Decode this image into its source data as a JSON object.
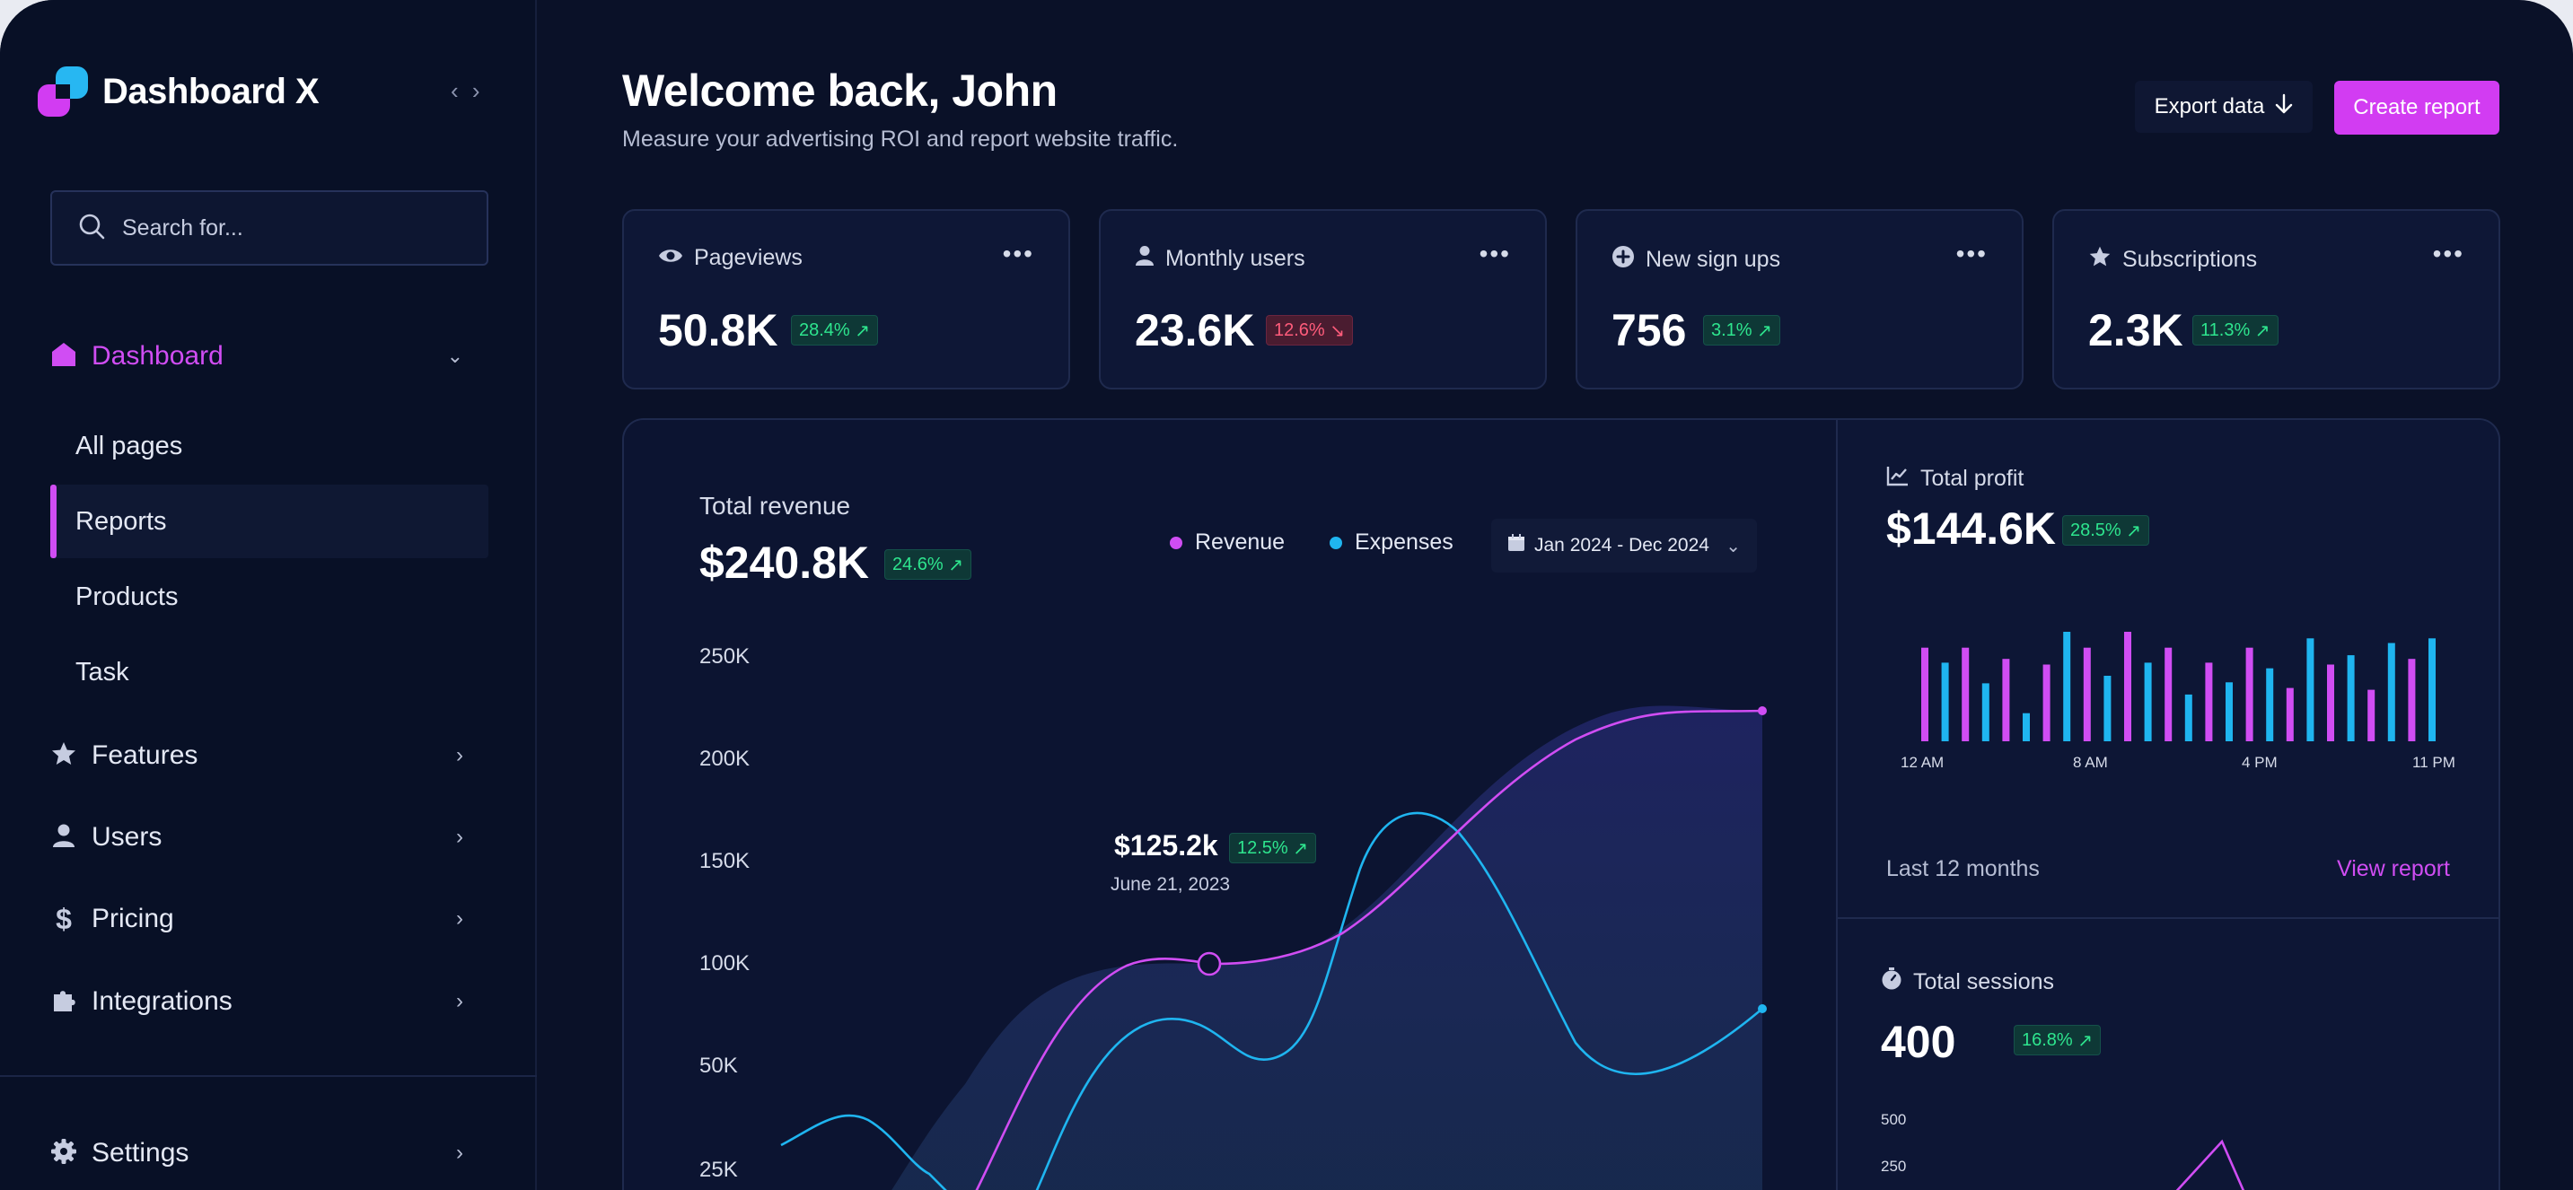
{
  "app": {
    "name": "Dashboard X"
  },
  "sidebar": {
    "search_placeholder": "Search for...",
    "main_item": "Dashboard",
    "sub_items": [
      "All pages",
      "Reports",
      "Products",
      "Task"
    ],
    "active_sub_item": "Reports",
    "items": [
      "Features",
      "Users",
      "Pricing",
      "Integrations"
    ],
    "settings_label": "Settings"
  },
  "header": {
    "title": "Welcome back, John",
    "subtitle": "Measure your advertising ROI and report website traffic.",
    "export_label": "Export data",
    "create_label": "Create report"
  },
  "stats": [
    {
      "label": "Pageviews",
      "value": "50.8K",
      "change": "28.4%",
      "trend": "up",
      "icon": "eye-icon"
    },
    {
      "label": "Monthly users",
      "value": "23.6K",
      "change": "12.6%",
      "trend": "down",
      "icon": "user-icon"
    },
    {
      "label": "New sign ups",
      "value": "756",
      "change": "3.1%",
      "trend": "up",
      "icon": "plus-circle-icon"
    },
    {
      "label": "Subscriptions",
      "value": "2.3K",
      "change": "11.3%",
      "trend": "up",
      "icon": "star-icon"
    }
  ],
  "revenue": {
    "label": "Total revenue",
    "value": "$240.8K",
    "change": "24.6%",
    "legend": [
      "Revenue",
      "Expenses"
    ],
    "date_range": "Jan 2024 - Dec 2024",
    "tooltip": {
      "value": "$125.2k",
      "change": "12.5%",
      "date": "June 21, 2023"
    }
  },
  "profit": {
    "label": "Total profit",
    "value": "$144.6K",
    "change": "28.5%",
    "hour_labels": [
      "12 AM",
      "8 AM",
      "4 PM",
      "11 PM"
    ],
    "footer_label": "Last 12 months",
    "link_label": "View report"
  },
  "sessions": {
    "label": "Total sessions",
    "value": "400",
    "change": "16.8%",
    "y_ticks": [
      "500",
      "250"
    ]
  },
  "colors": {
    "accent": "#d04df3",
    "revenue": "#d04df3",
    "expenses": "#1fb5f0",
    "positive": "#2ee58e",
    "negative": "#ff5c7b"
  },
  "chart_data": [
    {
      "type": "area",
      "title": "Total revenue",
      "y_ticks": [
        "250K",
        "200K",
        "150K",
        "100K",
        "50K",
        "25K"
      ],
      "ylim": [
        25000,
        250000
      ],
      "series": [
        {
          "name": "Revenue",
          "values": [
            0,
            0,
            0,
            45000,
            90000,
            100000,
            100000,
            110000,
            145000,
            185000,
            215000,
            225000
          ]
        },
        {
          "name": "Expenses",
          "values": [
            40000,
            15000,
            25000,
            75000,
            60000,
            140000,
            160000,
            100000,
            70000,
            75000
          ]
        }
      ],
      "legend": "top",
      "grid": false
    },
    {
      "type": "bar",
      "title": "Total profit",
      "x_tick_labels": [
        "12 AM",
        "8 AM",
        "4 PM",
        "11 PM"
      ],
      "series": [
        {
          "name": "",
          "values": [
            100,
            84,
            100,
            62,
            88,
            30,
            82,
            117,
            100,
            70,
            117,
            84,
            100,
            50,
            84,
            63,
            100,
            78,
            57,
            110,
            82,
            92,
            55,
            105,
            88,
            110
          ]
        }
      ],
      "legend": "none",
      "grid": false
    },
    {
      "type": "line",
      "title": "Total sessions",
      "y_ticks": [
        "500",
        "250"
      ],
      "series": [
        {
          "name": "",
          "values": [
            390
          ]
        }
      ],
      "legend": "none",
      "grid": false
    }
  ]
}
